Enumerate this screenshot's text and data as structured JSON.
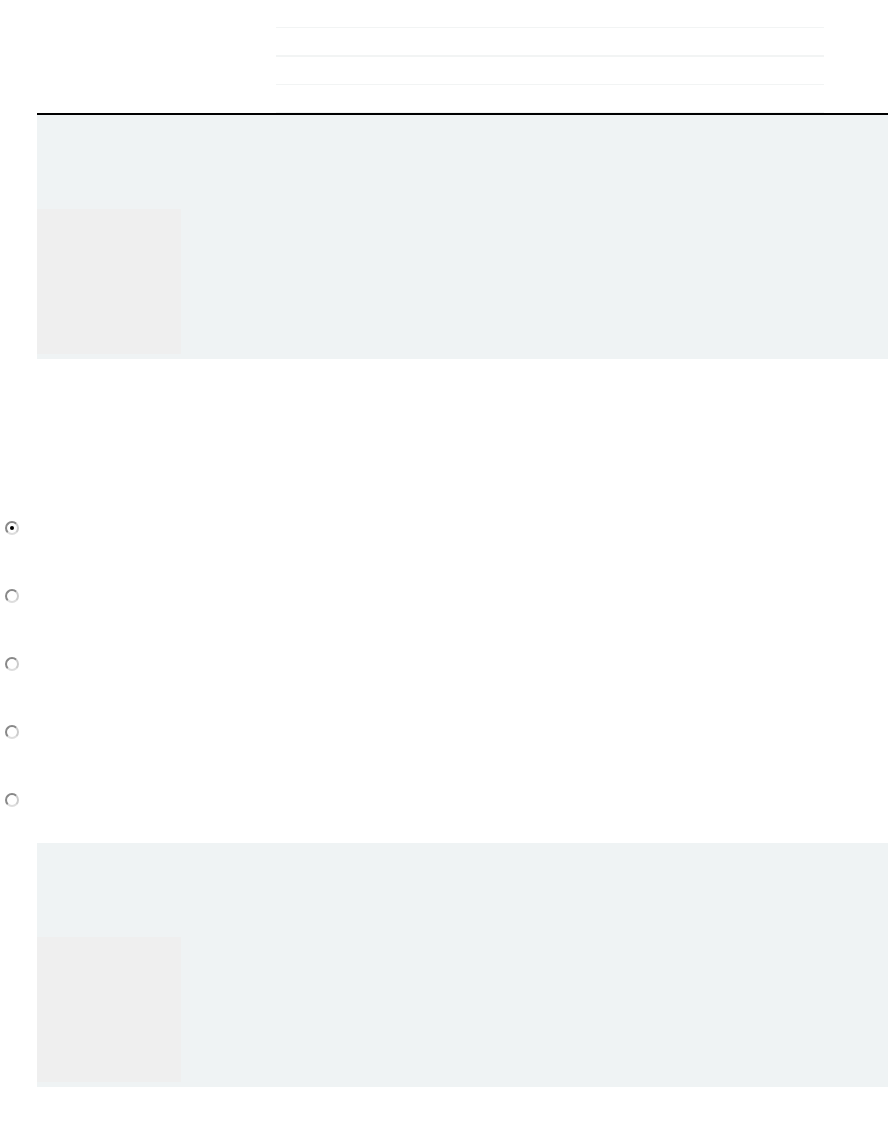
{
  "rules": [
    {
      "kind": "rule"
    },
    {
      "kind": "rule"
    },
    {
      "kind": "rule"
    },
    {
      "kind": "rule"
    }
  ],
  "sections": [
    {
      "kind": "panel"
    },
    {
      "kind": "radio_group",
      "options": [
        {
          "selected": true
        },
        {
          "selected": false
        },
        {
          "selected": false
        },
        {
          "selected": false
        },
        {
          "selected": false
        }
      ]
    },
    {
      "kind": "panel"
    }
  ]
}
